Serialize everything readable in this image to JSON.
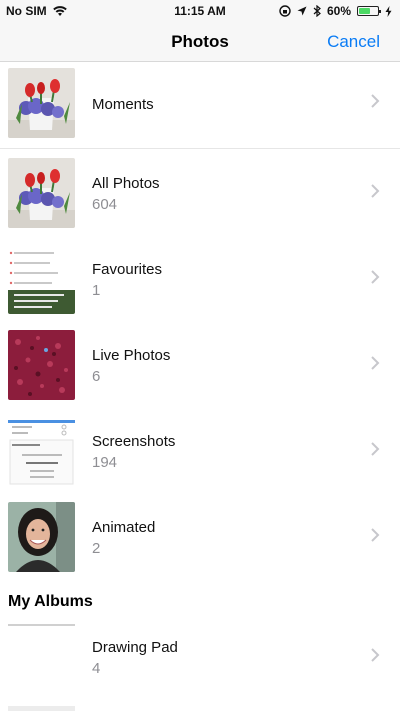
{
  "status_bar": {
    "carrier": "No SIM",
    "time": "11:15 AM",
    "battery": "60%",
    "battery_level": 0.6
  },
  "nav": {
    "title": "Photos",
    "cancel_label": "Cancel"
  },
  "albums": [
    {
      "title": "Moments",
      "count": ""
    },
    {
      "title": "All Photos",
      "count": "604"
    },
    {
      "title": "Favourites",
      "count": "1"
    },
    {
      "title": "Live Photos",
      "count": "6"
    },
    {
      "title": "Screenshots",
      "count": "194"
    },
    {
      "title": "Animated",
      "count": "2"
    }
  ],
  "my_albums": {
    "header": "My Albums",
    "items": [
      {
        "title": "Drawing Pad",
        "count": "4"
      }
    ]
  },
  "colors": {
    "accent": "#0a7cf5",
    "secondary_text": "#8e8e93",
    "battery_green": "#4cd964"
  }
}
